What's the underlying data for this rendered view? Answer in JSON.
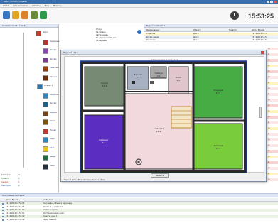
{
  "window": {
    "title": "АРМ — ЕСЕЛ: Объект"
  },
  "menu": {
    "items": [
      "Файл",
      "Справочники",
      "Отчёты",
      "Вид",
      "Помощь"
    ]
  },
  "toolbar": {
    "clock": "15:53:25",
    "icons": [
      "house-icon",
      "key-icon",
      "pencil-icon",
      "gear-icon",
      "check-icon"
    ]
  },
  "left_panel": {
    "title": "Состояние объектов",
    "tree": [
      {
        "label": "Дом 1",
        "color": "#c0392b"
      },
      {
        "label": "Охранный",
        "color": "#b03a2e"
      },
      {
        "label": "Датчик",
        "color": "#8e44ad"
      },
      {
        "label": "Датчик",
        "color": "#7d3c98"
      },
      {
        "label": "Сигнализ.",
        "color": "#a04000"
      },
      {
        "label": "Камера",
        "color": "#6e2c00"
      },
      {
        "label": "Объект 2",
        "color": "#2874a6"
      },
      {
        "label": "Контроль",
        "color": "#2e86c1"
      },
      {
        "label": "Датчик",
        "color": "#1f618d"
      },
      {
        "label": "Охрана",
        "color": "#784212"
      },
      {
        "label": "Замок",
        "color": "#7e5109"
      },
      {
        "label": "Пожар",
        "color": "#c0392b"
      },
      {
        "label": "Вода",
        "color": "#2e86c1"
      },
      {
        "label": "Свет",
        "color": "#f1c40f"
      },
      {
        "label": "Двери",
        "color": "#196f3d"
      },
      {
        "label": "Окна",
        "color": "#212f3c"
      }
    ],
    "legend": [
      {
        "label": "Состояние",
        "value": "4"
      },
      {
        "label": "Тревога",
        "value": "2"
      },
      {
        "label": "Авария",
        "value": "1"
      },
      {
        "label": "Неисправ.",
        "value": "0"
      }
    ]
  },
  "props_panel": {
    "rows": [
      "Статус",
      "На охране",
      "Авторизован",
      "Не назначено объект",
      "Нет данных"
    ]
  },
  "right_panel": {
    "title": "Журнал событий",
    "columns": [
      "Наименование",
      "Объект",
      "Тревога",
      "Дата / Время"
    ],
    "rows": [
      {
        "name": "Открытие",
        "object": "Дом 1",
        "alarm": "",
        "time": "15.12.2011 15:52"
      },
      {
        "name": "Датчик двери",
        "object": "Дом 1",
        "alarm": "",
        "time": "15.12.2011 15:52"
      },
      {
        "name": "Движение",
        "object": "Дом 1",
        "alarm": "",
        "time": "15.12.2011 15:53"
      }
    ]
  },
  "side_strip": {
    "cells": [
      "Пн",
      "Вт",
      "Ср",
      "Чт",
      "Пт",
      "Сб",
      "Вс",
      "Пн",
      "Вт",
      "Ср",
      "Чт",
      "Пт",
      "Сб",
      "Вс",
      "Пн",
      "Вт",
      "Ср",
      "Чт",
      "Пт",
      "Сб",
      "Вс",
      "Пн",
      "Вт",
      "Ср"
    ],
    "colors": [
      "#fde7e7",
      "#fde7e7",
      "#f9d2d2",
      "#fff4c2",
      "#f9d2d2",
      "#fde7e7",
      "#fff4c2",
      "#fde7e7"
    ]
  },
  "dialog": {
    "title": "Первый этаж",
    "caption": "Планировка 1-го этажа",
    "button": "Закрыть",
    "tabs": "Первый этаж | Второй этаж | Подвал | Двор",
    "rooms": [
      {
        "name": "Кухня",
        "area": "11.1",
        "color": "#778a73"
      },
      {
        "name": "Гостиная",
        "area": "19.4",
        "color": "#f1d9dd"
      },
      {
        "name": "Ванная",
        "area": "3.3",
        "color": "#a7b1c2"
      },
      {
        "name": "Спальня",
        "area": "14.5",
        "color": "#48ac45"
      },
      {
        "name": "Детская",
        "area": "15.1",
        "color": "#79cc3a"
      },
      {
        "name": "Кабинет",
        "area": "7.2",
        "color": "#5b2dc0"
      },
      {
        "name": "Тамбур",
        "area": "2.1",
        "color": "#a8a8a8"
      },
      {
        "name": "Холл",
        "area": "6.0",
        "color": "#e0c6cc"
      }
    ]
  },
  "bottom_panel": {
    "title": "Состояние системы",
    "columns": [
      "Дата / Время",
      "Сообщение"
    ],
    "rows": [
      {
        "time": "15.12.2011 15:50:15",
        "msg": "Постановка объекта на охрану"
      },
      {
        "time": "15.12.2011 15:51:02",
        "msg": "Датчик 2 — сработка"
      },
      {
        "time": "15.12.2011 15:51:33",
        "msg": "Снятие с охраны"
      },
      {
        "time": "15.12.2011 15:52:01",
        "msg": "Восстановление связи"
      },
      {
        "time": "15.12.2011 15:52:40",
        "msg": "Тревога: зона 1"
      },
      {
        "time": "15.12.2011 15:53:10",
        "msg": "Сброс тревоги"
      }
    ]
  }
}
